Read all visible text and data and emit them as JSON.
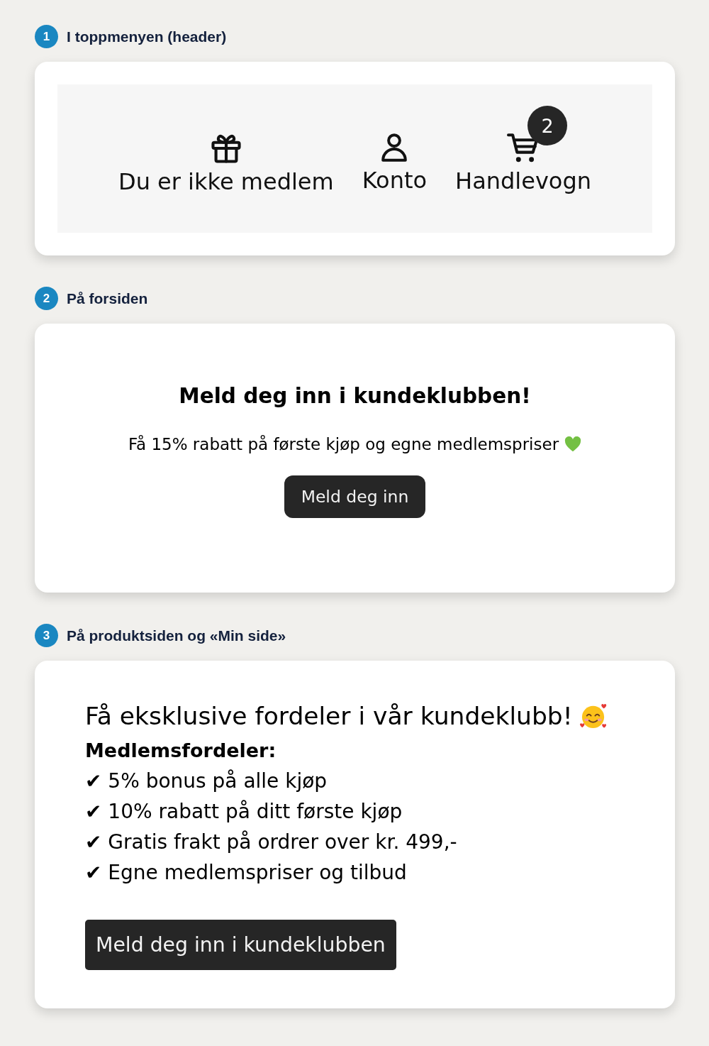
{
  "sections": [
    {
      "number": "1",
      "label": "I toppmenyen (header)",
      "kind": "header",
      "nav": [
        {
          "kind": "gift",
          "label": "Du er ikke medlem"
        },
        {
          "kind": "account",
          "label": "Konto"
        },
        {
          "kind": "cart",
          "label": "Handlevogn",
          "count": "2"
        }
      ]
    },
    {
      "number": "2",
      "label": "På forsiden",
      "kind": "banner",
      "heading": "Meld deg inn i kundeklubben!",
      "text": "Få 15% rabatt på første kjøp og egne medlemspriser",
      "button": "Meld deg inn"
    },
    {
      "number": "3",
      "label": "På produktsiden og «Min side»",
      "kind": "benefits",
      "title": "Få eksklusive fordeler i vår kundeklubb!",
      "subtitle": "Medlemsfordeler:",
      "items": [
        "✔ 5% bonus på alle kjøp",
        "✔ 10% rabatt på ditt første kjøp",
        "✔ Gratis frakt på ordrer over kr. 499,-",
        "✔ Egne medlemspriser og tilbud"
      ],
      "button": "Meld deg inn i kundeklubben"
    }
  ]
}
